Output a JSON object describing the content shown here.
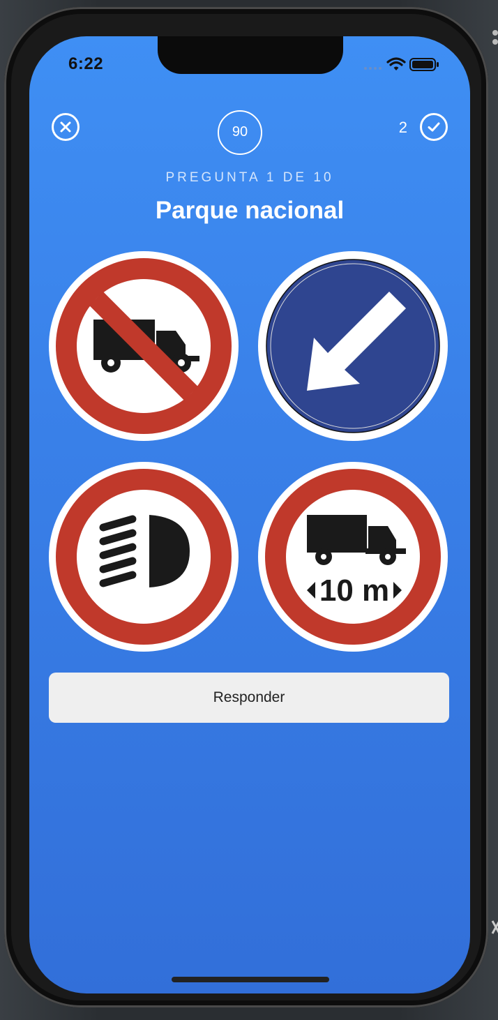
{
  "status_bar": {
    "time": "6:22"
  },
  "header": {
    "timer_value": "90",
    "score_count": "2",
    "question_counter": "PREGUNTA 1 DE 10",
    "question_title": "Parque nacional"
  },
  "options": [
    {
      "sign": "no-trucks-sign"
    },
    {
      "sign": "keep-left-sign"
    },
    {
      "sign": "no-high-beam-sign"
    },
    {
      "sign": "max-length-sign",
      "sign_text": "10 m"
    }
  ],
  "actions": {
    "answer_label": "Responder"
  },
  "colors": {
    "accent_blue": "#3a82ea",
    "sign_red": "#c0392b",
    "sign_blue": "#2f4590",
    "button_bg": "#efefef"
  }
}
